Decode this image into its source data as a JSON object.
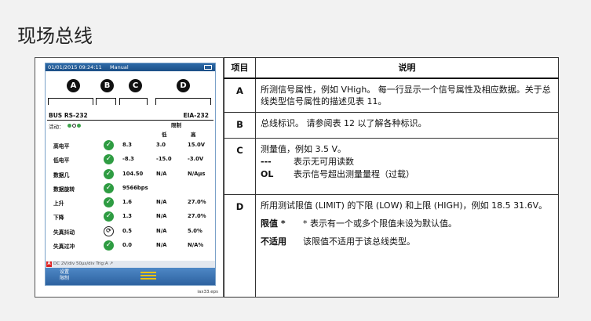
{
  "page": {
    "title": "现场总线"
  },
  "device": {
    "date": "01/01/2015 09:24:11",
    "mode": "Manual",
    "callouts": [
      "A",
      "B",
      "C",
      "D"
    ],
    "bus_name": "BUS RS-232",
    "bus_type": "EIA-232",
    "activity_label": "活动：",
    "limit_label": "限制",
    "low_label": "低",
    "high_label": "高",
    "rows": [
      {
        "name": "高电平",
        "status": "pass",
        "value": "8.3",
        "low": "3.0",
        "high": "15.0V"
      },
      {
        "name": "低电平",
        "status": "pass",
        "value": "-8.3",
        "low": "-15.0",
        "high": "-3.0V"
      },
      {
        "name": "数据几",
        "status": "pass",
        "value": "104.50",
        "low": "N/A",
        "high": "N/Aμs"
      },
      {
        "name": "数据旋转",
        "status": "pass",
        "value": "9566bps",
        "low": "",
        "high": ""
      },
      {
        "name": "上升",
        "status": "pass",
        "value": "1.6",
        "low": "N/A",
        "high": "27.0%"
      },
      {
        "name": "下降",
        "status": "pass",
        "value": "1.3",
        "low": "N/A",
        "high": "27.0%"
      },
      {
        "name": "失真抖动",
        "status": "warn",
        "value": "0.5",
        "low": "N/A",
        "high": "5.0%"
      },
      {
        "name": "失真过冲",
        "status": "pass",
        "value": "0.0",
        "low": "N/A",
        "high": "N/A%"
      }
    ],
    "status_strip": "DC      2V/div      50μs/div  Trig:A  ↗",
    "softkey_setup": "设置\n限制",
    "figure_id": "iax33.eps"
  },
  "table": {
    "header_item": "项目",
    "header_desc": "说明",
    "rows": [
      {
        "item": "A",
        "desc": "所测信号属性，例如 VHigh。 每一行显示一个信号属性及相应数据。关于总线类型信号属性的描述见表 11。"
      },
      {
        "item": "B",
        "desc": "总线标识。 请参阅表 12 以了解各种标识。"
      },
      {
        "item": "C",
        "desc": "测量值，例如 3.5 V。",
        "sub": [
          {
            "k": "---",
            "v": "表示无可用读数"
          },
          {
            "k": "OL",
            "v": "表示信号超出测量量程（过载）"
          }
        ]
      },
      {
        "item": "D",
        "desc": "所用测试限值 (LIMIT) 的下限 (LOW) 和上限 (HIGH)，例如 18.5 31.6V。",
        "sub": [
          {
            "k": "限值 *",
            "v": "* 表示有一个或多个限值未设为默认值。"
          },
          {
            "k": "不适用",
            "v": "该限值不适用于该总线类型。"
          }
        ]
      }
    ]
  }
}
